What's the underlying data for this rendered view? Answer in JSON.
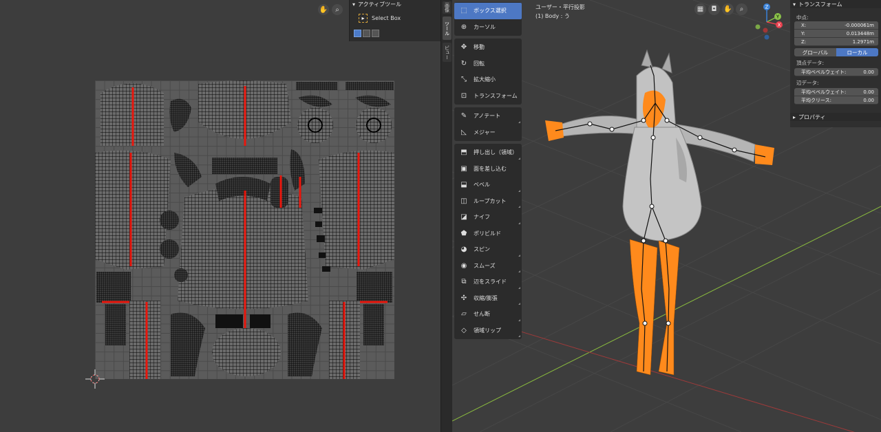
{
  "uv_editor": {
    "tools_panel_title": "アクティブツール",
    "select_box_label": "Select Box"
  },
  "side_tabs": [
    "ビュー",
    "ツール",
    "画像"
  ],
  "toolbar": {
    "tools": [
      {
        "label": "ボックス選択",
        "icon": "select-box-icon",
        "active": true
      },
      {
        "label": "カーソル",
        "icon": "cursor-icon"
      },
      {
        "label": "移動",
        "icon": "move-icon"
      },
      {
        "label": "回転",
        "icon": "rotate-icon"
      },
      {
        "label": "拡大縮小",
        "icon": "scale-icon"
      },
      {
        "label": "トランスフォーム",
        "icon": "transform-icon"
      },
      {
        "label": "アノテート",
        "icon": "annotate-icon"
      },
      {
        "label": "メジャー",
        "icon": "measure-icon"
      },
      {
        "label": "押し出し（領域）",
        "icon": "extrude-icon"
      },
      {
        "label": "面を差し込む",
        "icon": "inset-icon"
      },
      {
        "label": "ベベル",
        "icon": "bevel-icon"
      },
      {
        "label": "ループカット",
        "icon": "loop-cut-icon"
      },
      {
        "label": "ナイフ",
        "icon": "knife-icon"
      },
      {
        "label": "ポリビルド",
        "icon": "poly-build-icon"
      },
      {
        "label": "スピン",
        "icon": "spin-icon"
      },
      {
        "label": "スムーズ",
        "icon": "smooth-icon"
      },
      {
        "label": "辺をスライド",
        "icon": "edge-slide-icon"
      },
      {
        "label": "収縮/膨張",
        "icon": "shrink-fatten-icon"
      },
      {
        "label": "せん断",
        "icon": "shear-icon"
      },
      {
        "label": "領域リップ",
        "icon": "rip-region-icon"
      }
    ]
  },
  "viewport": {
    "view_name": "ユーザー・平行投影",
    "object_info": "(1) Body : う",
    "axis_x": "X",
    "axis_y": "Y",
    "axis_z": "Z"
  },
  "n_panel": {
    "transform_title": "トランスフォーム",
    "median_label": "中点:",
    "x_label": "X:",
    "x_value": "-0.000061m",
    "y_label": "Y:",
    "y_value": "0.013448m",
    "z_label": "Z:",
    "z_value": "1.2971m",
    "global_label": "グローバル",
    "local_label": "ローカル",
    "vertex_data_label": "頂点データ:",
    "vertex_bevel_label": "平均ベベルウェイト:",
    "vertex_bevel_value": "0.00",
    "edge_data_label": "辺データ:",
    "edge_bevel_label": "平均ベベルウェイト:",
    "edge_bevel_value": "0.00",
    "edge_crease_label": "平均クリース:",
    "edge_crease_value": "0.00",
    "properties_title": "プロパティ"
  },
  "colors": {
    "accent": "#4d78c4",
    "selection": "#ff8a1c",
    "seam": "#e8160c",
    "axis_x": "#e8404e",
    "axis_y": "#8bc34a",
    "axis_z": "#3a82d8"
  }
}
